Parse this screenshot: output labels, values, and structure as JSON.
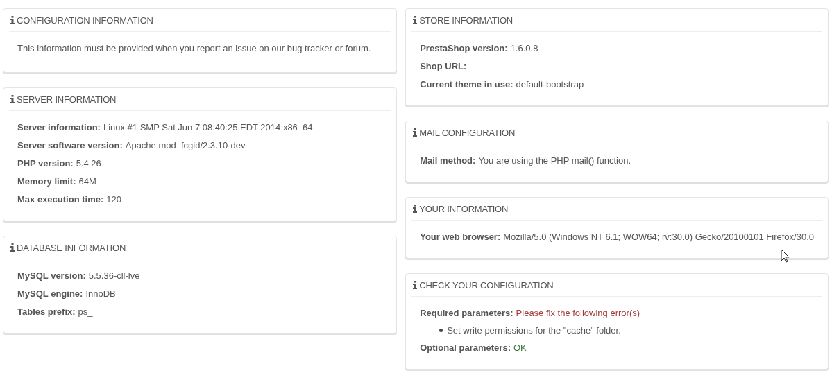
{
  "columns": [
    {
      "panels": [
        {
          "title": "CONFIGURATION INFORMATION",
          "text": "This information must be provided when you report an issue on our bug tracker or forum."
        },
        {
          "title": "SERVER INFORMATION",
          "rows": [
            {
              "label": "Server information:",
              "value": "Linux #1 SMP Sat Jun 7 08:40:25 EDT 2014 x86_64"
            },
            {
              "label": "Server software version:",
              "value": "Apache mod_fcgid/2.3.10-dev"
            },
            {
              "label": "PHP version:",
              "value": "5.4.26"
            },
            {
              "label": "Memory limit:",
              "value": "64M"
            },
            {
              "label": "Max execution time:",
              "value": "120"
            }
          ]
        },
        {
          "title": "DATABASE INFORMATION",
          "rows": [
            {
              "label": "MySQL version:",
              "value": "5.5.36-cll-lve"
            },
            {
              "label": "MySQL engine:",
              "value": "InnoDB"
            },
            {
              "label": "Tables prefix:",
              "value": "ps_"
            }
          ]
        }
      ]
    },
    {
      "panels": [
        {
          "title": "STORE INFORMATION",
          "rows": [
            {
              "label": "PrestaShop version:",
              "value": "1.6.0.8"
            },
            {
              "label": "Shop URL:"
            },
            {
              "label": "Current theme in use:",
              "value": "default-bootstrap"
            }
          ]
        },
        {
          "title": "MAIL CONFIGURATION",
          "rows": [
            {
              "label": "Mail method:",
              "value": "You are using the PHP mail() function."
            }
          ]
        },
        {
          "title": "YOUR INFORMATION",
          "rows": [
            {
              "label": "Your web browser:",
              "value": "Mozilla/5.0 (Windows NT 6.1; WOW64; rv:30.0) Gecko/20100101 Firefox/30.0"
            }
          ]
        },
        {
          "title": "CHECK YOUR CONFIGURATION",
          "rows": [
            {
              "label": "Required parameters:",
              "value": "Please fix the following error(s)",
              "kind": "error",
              "items": [
                "Set write permissions for the \"cache\" folder."
              ]
            },
            {
              "label": "Optional parameters:",
              "value": "OK",
              "kind": "ok"
            }
          ]
        }
      ]
    }
  ]
}
